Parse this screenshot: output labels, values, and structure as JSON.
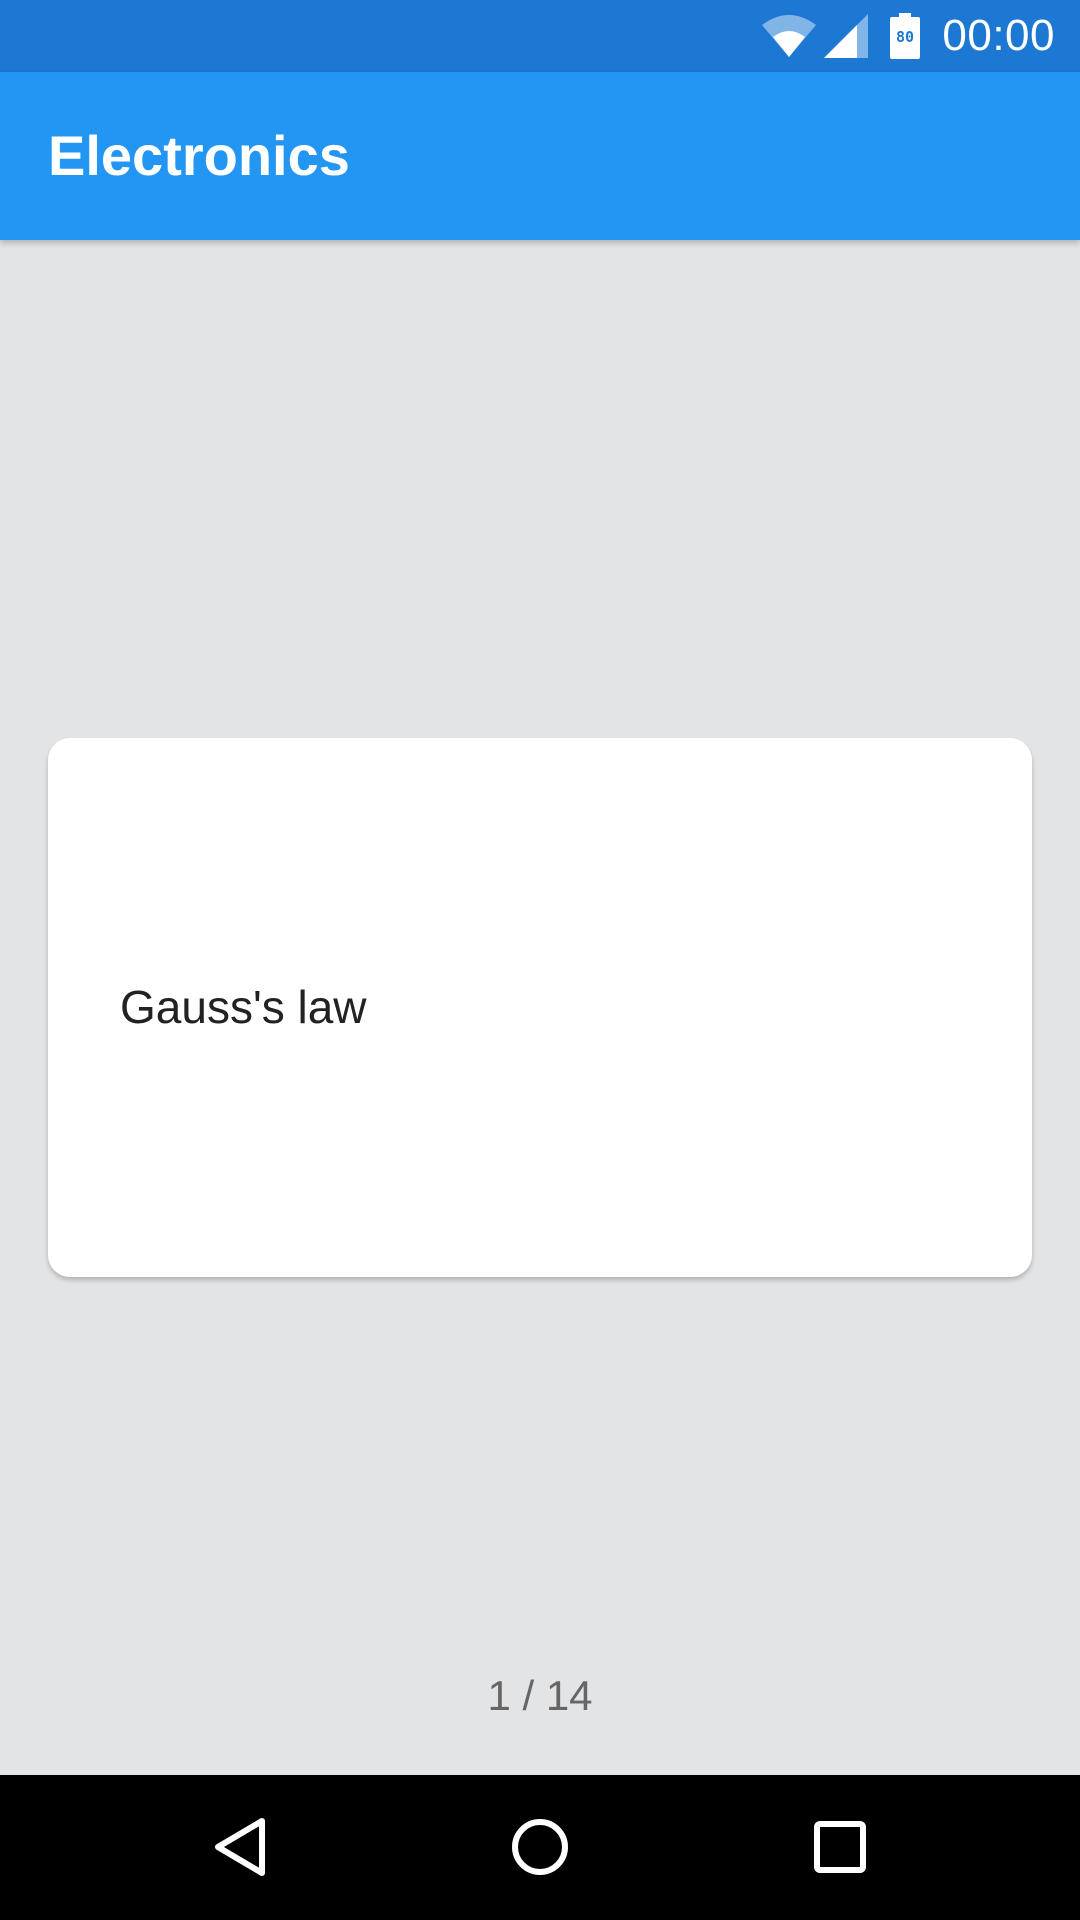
{
  "status_bar": {
    "time": "00:00",
    "battery_level": "80",
    "icons": [
      "wifi-icon",
      "cell-signal-icon",
      "battery-icon"
    ],
    "color": "#1c78d3"
  },
  "app_bar": {
    "title": "Electronics",
    "color": "#2396f3"
  },
  "card": {
    "text": "Gauss's law"
  },
  "pager": {
    "text": "1 / 14",
    "current": 1,
    "total": 14
  },
  "nav_bar": {
    "icons": [
      "back-icon",
      "home-icon",
      "recents-icon"
    ]
  },
  "colors": {
    "background": "#e3e4e6",
    "card": "#ffffff",
    "nav": "#000000"
  }
}
